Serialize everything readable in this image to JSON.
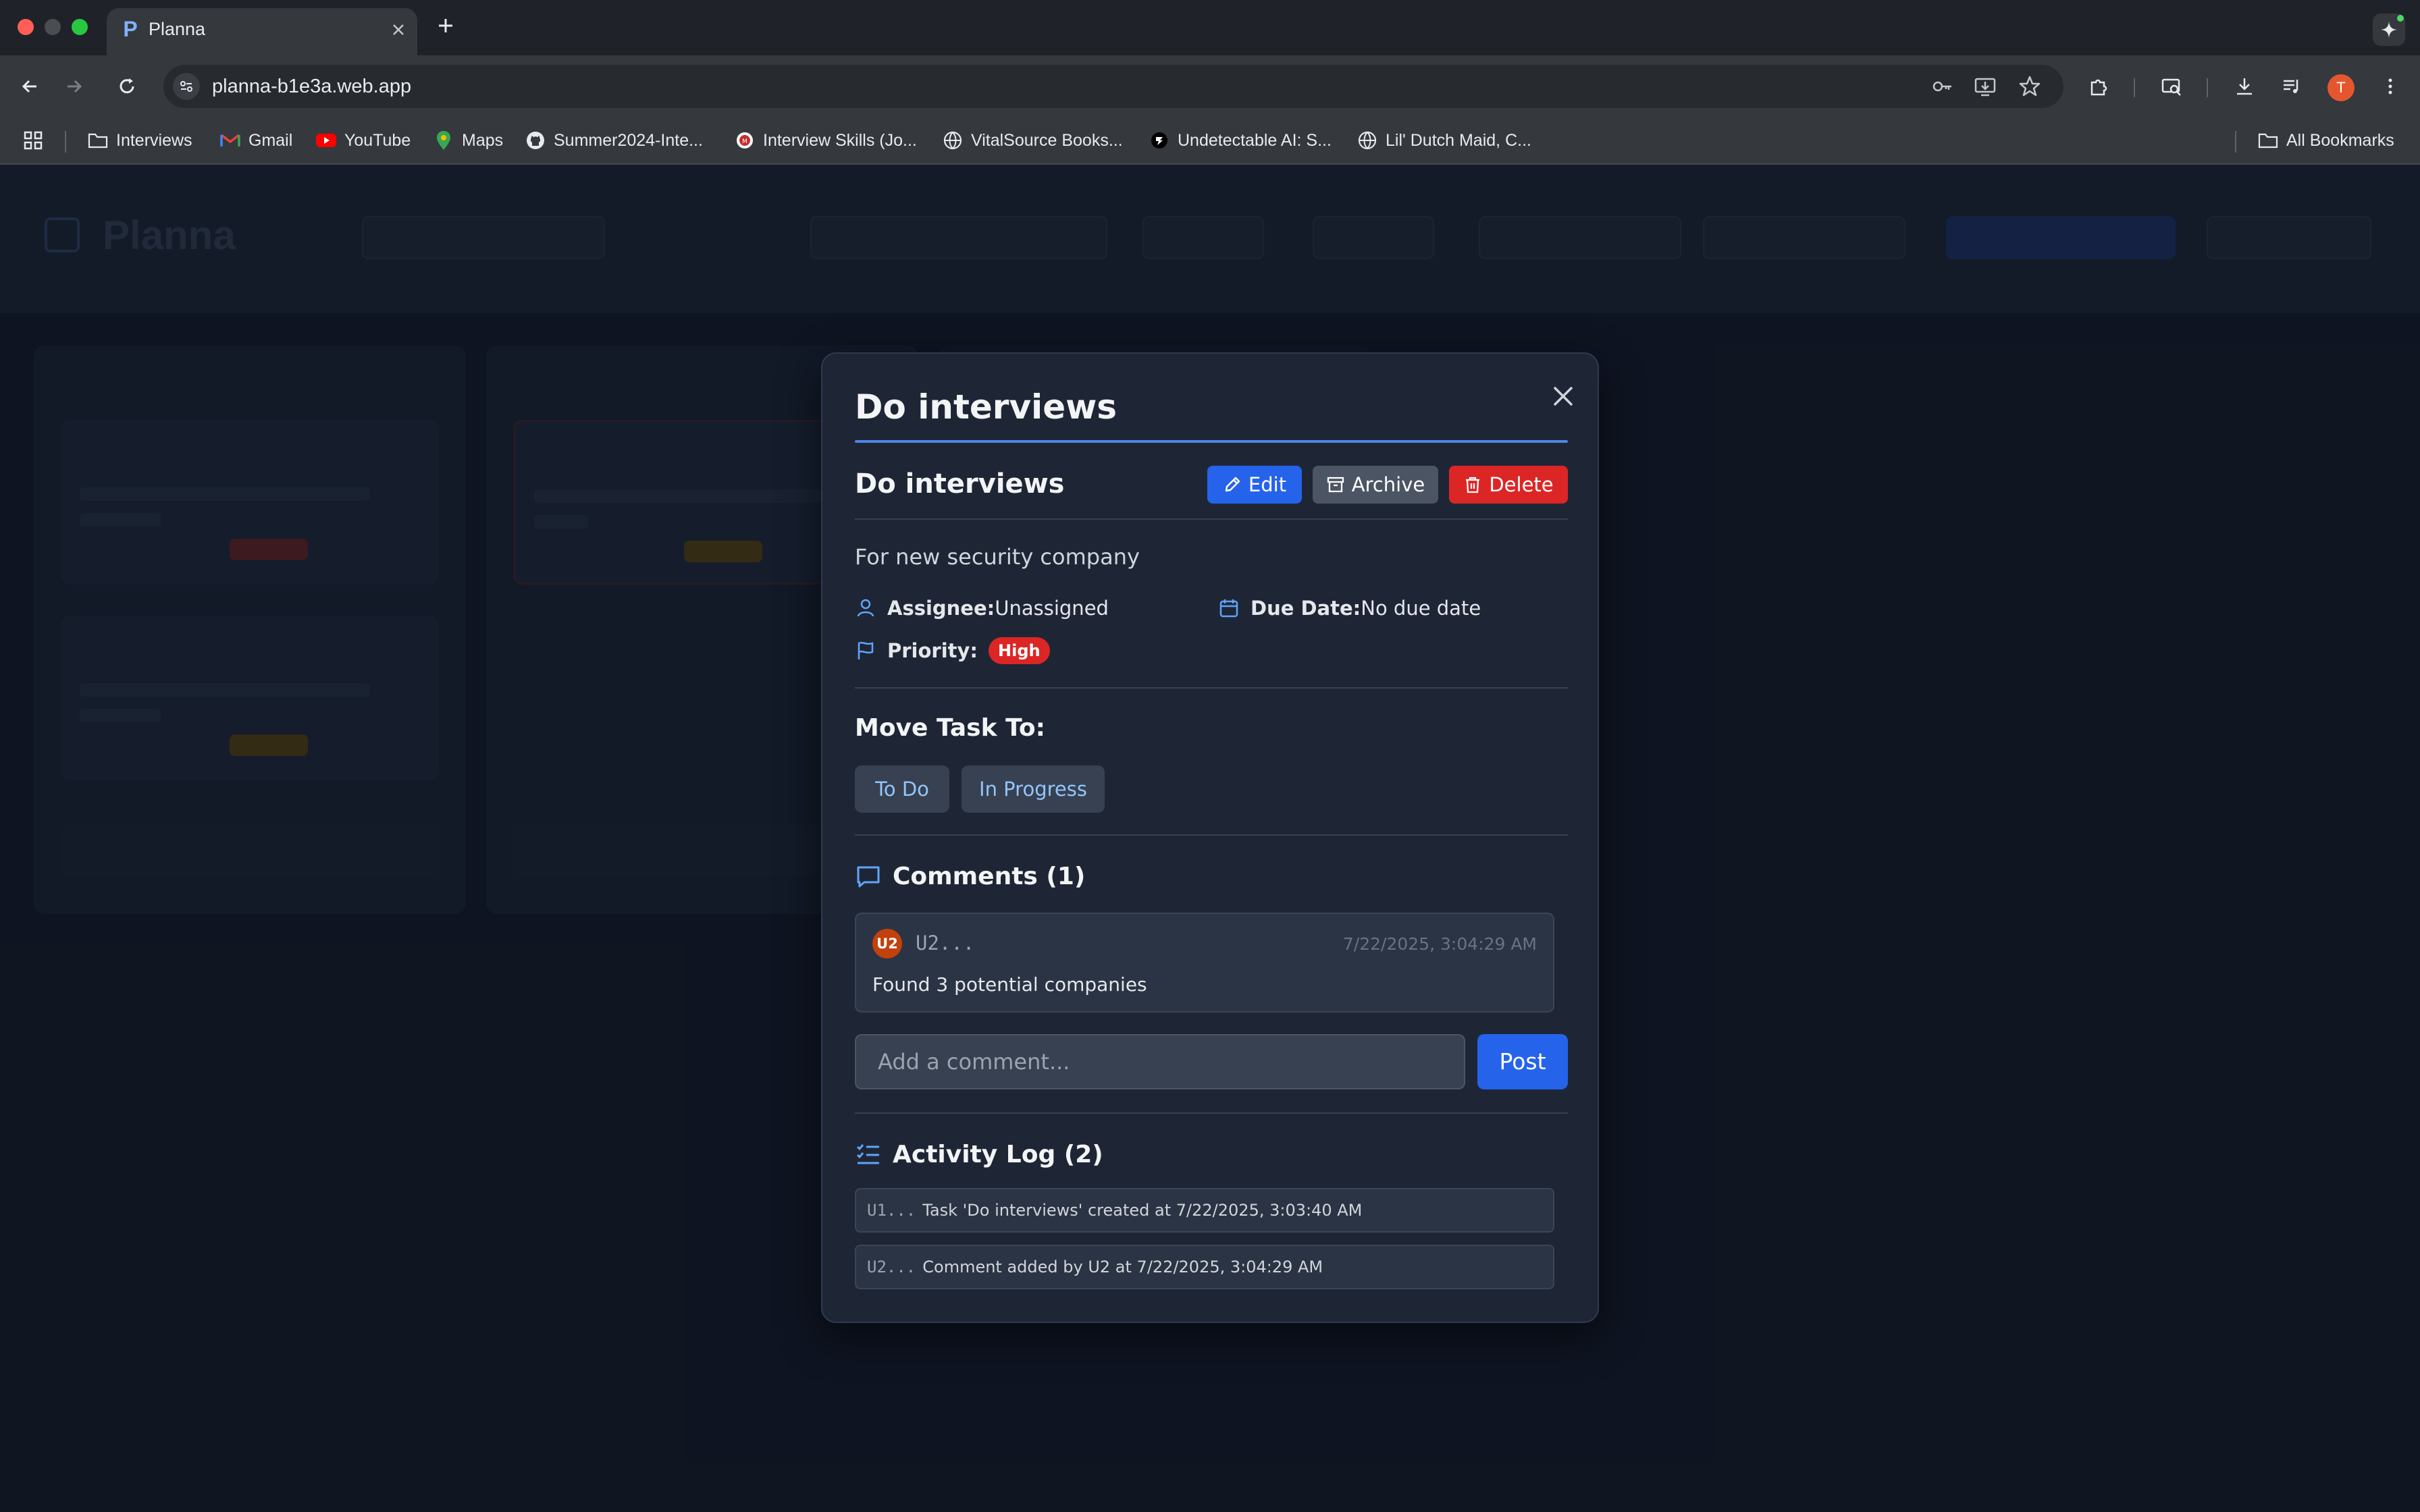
{
  "browser": {
    "tab_title": "Planna",
    "tab_favicon": "P",
    "url": "planna-b1e3a.web.app",
    "profile_initial": "T",
    "bookmarks": [
      {
        "label": "Interviews",
        "icon": "folder-icon"
      },
      {
        "label": "Gmail",
        "icon": "gmail-icon"
      },
      {
        "label": "YouTube",
        "icon": "youtube-icon"
      },
      {
        "label": "Maps",
        "icon": "maps-icon"
      },
      {
        "label": "Summer2024-Inte...",
        "icon": "github-icon"
      },
      {
        "label": "Interview Skills (Jo...",
        "icon": "globe-icon"
      },
      {
        "label": "VitalSource Books...",
        "icon": "globe-icon"
      },
      {
        "label": "Undetectable AI: S...",
        "icon": "undetectable-icon"
      },
      {
        "label": "Lil' Dutch Maid, C...",
        "icon": "globe-icon"
      }
    ],
    "all_bookmarks": "All Bookmarks"
  },
  "app": {
    "logo": "Planna"
  },
  "modal": {
    "title": "Do interviews",
    "task_name": "Do interviews",
    "edit_label": "Edit",
    "archive_label": "Archive",
    "delete_label": "Delete",
    "description": "For new security company",
    "assignee_label": "Assignee:",
    "assignee_value": "Unassigned",
    "due_label": "Due Date:",
    "due_value": "No due date",
    "priority_label": "Priority:",
    "priority_value": "High",
    "move_heading": "Move Task To:",
    "move_options": [
      "To Do",
      "In Progress"
    ],
    "comments_heading": "Comments (1)",
    "comments": [
      {
        "avatar": "U2",
        "user": "U2...",
        "time": "7/22/2025, 3:04:29 AM",
        "text": "Found 3 potential companies"
      }
    ],
    "comment_placeholder": "Add a comment...",
    "post_label": "Post",
    "log_heading": "Activity Log (2)",
    "log": [
      {
        "user": "U1...",
        "text": "Task 'Do interviews' created at 7/22/2025, 3:03:40 AM"
      },
      {
        "user": "U2...",
        "text": "Comment added by U2 at 7/22/2025, 3:04:29 AM"
      }
    ]
  },
  "colors": {
    "accent": "#2563eb",
    "danger": "#dc2626",
    "modal_bg": "#1e2636"
  }
}
